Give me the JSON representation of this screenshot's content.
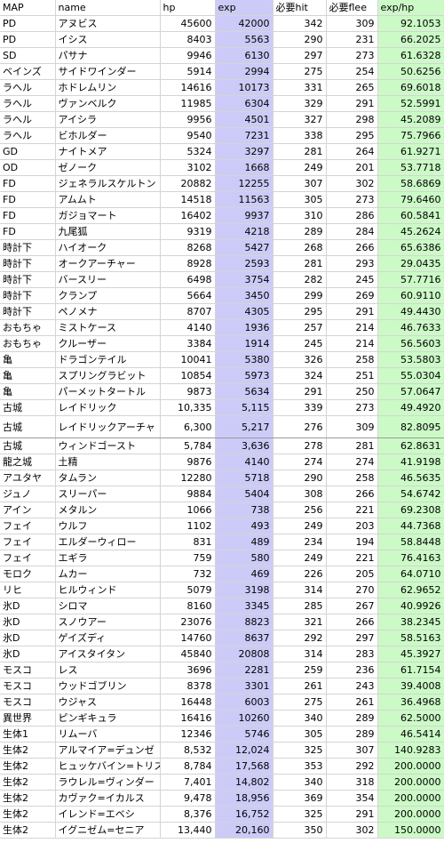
{
  "headers": [
    "MAP",
    "name",
    "hp",
    "exp",
    "必要hit",
    "必要flee",
    "exp/hp"
  ],
  "rows": [
    [
      "PD",
      "アヌビス",
      "45600",
      "42000",
      "342",
      "309",
      "92.1053"
    ],
    [
      "PD",
      "イシス",
      "8403",
      "5563",
      "290",
      "231",
      "66.2025"
    ],
    [
      "SD",
      "パサナ",
      "9946",
      "6130",
      "297",
      "273",
      "61.6328"
    ],
    [
      "ベインズ",
      "サイドワインダー",
      "5914",
      "2994",
      "275",
      "254",
      "50.6256"
    ],
    [
      "ラヘル",
      "ホドレムリン",
      "14616",
      "10173",
      "331",
      "265",
      "69.6018"
    ],
    [
      "ラヘル",
      "ヴァンベルク",
      "11985",
      "6304",
      "329",
      "291",
      "52.5991"
    ],
    [
      "ラヘル",
      "アイシラ",
      "9956",
      "4501",
      "327",
      "298",
      "45.2089"
    ],
    [
      "ラヘル",
      "ビホルダー",
      "9540",
      "7231",
      "338",
      "295",
      "75.7966"
    ],
    [
      "GD",
      "ナイトメア",
      "5324",
      "3297",
      "281",
      "264",
      "61.9271"
    ],
    [
      "OD",
      "ゼノーク",
      "3102",
      "1668",
      "249",
      "201",
      "53.7718"
    ],
    [
      "FD",
      "ジェネラルスケルトン",
      "20882",
      "12255",
      "307",
      "302",
      "58.6869"
    ],
    [
      "FD",
      "アムムト",
      "14518",
      "11563",
      "305",
      "273",
      "79.6460"
    ],
    [
      "FD",
      "ガジョマート",
      "16402",
      "9937",
      "310",
      "286",
      "60.5841"
    ],
    [
      "FD",
      "九尾狐",
      "9319",
      "4218",
      "289",
      "284",
      "45.2624"
    ],
    [
      "時計下",
      "ハイオーク",
      "8268",
      "5427",
      "268",
      "266",
      "65.6386"
    ],
    [
      "時計下",
      "オークアーチャー",
      "8928",
      "2593",
      "281",
      "293",
      "29.0435"
    ],
    [
      "時計下",
      "バースリー",
      "6498",
      "3754",
      "282",
      "245",
      "57.7716"
    ],
    [
      "時計下",
      "クランプ",
      "5664",
      "3450",
      "299",
      "269",
      "60.9110"
    ],
    [
      "時計下",
      "ペノメナ",
      "8707",
      "4305",
      "295",
      "291",
      "49.4430"
    ],
    [
      "おもちゃ",
      "ミストケース",
      "4140",
      "1936",
      "257",
      "214",
      "46.7633"
    ],
    [
      "おもちゃ",
      "クルーザー",
      "3384",
      "1914",
      "245",
      "214",
      "56.5603"
    ],
    [
      "亀",
      "ドラゴンテイル",
      "10041",
      "5380",
      "326",
      "258",
      "53.5803"
    ],
    [
      "亀",
      "スプリングラビット",
      "10854",
      "5973",
      "324",
      "251",
      "55.0304"
    ],
    [
      "亀",
      "パーメットタートル",
      "9873",
      "5634",
      "291",
      "250",
      "57.0647"
    ],
    [
      "古城",
      "レイドリック",
      "10,335",
      "5,115",
      "339",
      "273",
      "49.4920"
    ],
    [
      "古城",
      "レイドリックアーチャ",
      "6,300",
      "5,217",
      "276",
      "309",
      "82.8095"
    ],
    [
      "古城",
      "ウィンドゴースト",
      "5,784",
      "3,636",
      "278",
      "281",
      "62.8631"
    ],
    [
      "龍之城",
      "土精",
      "9876",
      "4140",
      "274",
      "274",
      "41.9198"
    ],
    [
      "アユタヤ",
      "タムラン",
      "12280",
      "5718",
      "290",
      "258",
      "46.5635"
    ],
    [
      "ジュノ",
      "スリーパー",
      "9884",
      "5404",
      "308",
      "266",
      "54.6742"
    ],
    [
      "アイン",
      "メタルン",
      "1066",
      "738",
      "256",
      "221",
      "69.2308"
    ],
    [
      "フェイ",
      "ウルフ",
      "1102",
      "493",
      "249",
      "203",
      "44.7368"
    ],
    [
      "フェイ",
      "エルダーウィロー",
      "831",
      "489",
      "234",
      "194",
      "58.8448"
    ],
    [
      "フェイ",
      "エギラ",
      "759",
      "580",
      "249",
      "221",
      "76.4163"
    ],
    [
      "モロク",
      "ムカー",
      "732",
      "469",
      "226",
      "205",
      "64.0710"
    ],
    [
      "リヒ",
      "ヒルウィンド",
      "5079",
      "3198",
      "314",
      "270",
      "62.9652"
    ],
    [
      "氷D",
      "シロマ",
      "8160",
      "3345",
      "285",
      "267",
      "40.9926"
    ],
    [
      "氷D",
      "スノウアー",
      "23076",
      "8823",
      "321",
      "266",
      "38.2345"
    ],
    [
      "氷D",
      "ゲイズディ",
      "14760",
      "8637",
      "292",
      "297",
      "58.5163"
    ],
    [
      "氷D",
      "アイスタイタン",
      "45840",
      "20808",
      "314",
      "283",
      "45.3927"
    ],
    [
      "モスコ",
      "レス",
      "3696",
      "2281",
      "259",
      "236",
      "61.7154"
    ],
    [
      "モスコ",
      "ウッドゴブリン",
      "8378",
      "3301",
      "261",
      "243",
      "39.4008"
    ],
    [
      "モスコ",
      "ウジャス",
      "16448",
      "6003",
      "275",
      "261",
      "36.4968"
    ],
    [
      "異世界",
      "ピンギキュラ",
      "16416",
      "10260",
      "340",
      "289",
      "62.5000"
    ],
    [
      "生体1",
      "リムーバ",
      "12346",
      "5746",
      "305",
      "289",
      "46.5414"
    ],
    [
      "生体2",
      "アルマイア=デュンゼ",
      "8,532",
      "12,024",
      "325",
      "307",
      "140.9283"
    ],
    [
      "生体2",
      "ヒュッケバイン=トリス",
      "8,784",
      "17,568",
      "353",
      "292",
      "200.0000"
    ],
    [
      "生体2",
      "ラウレル=ヴィンダー",
      "7,401",
      "14,802",
      "340",
      "318",
      "200.0000"
    ],
    [
      "生体2",
      "カヴァク=イカルス",
      "9,478",
      "18,956",
      "369",
      "354",
      "200.0000"
    ],
    [
      "生体2",
      "イレンド=エベシ",
      "8,376",
      "16,752",
      "325",
      "291",
      "200.0000"
    ],
    [
      "生体2",
      "イグニゼム=セニア",
      "13,440",
      "20,160",
      "350",
      "302",
      "150.0000"
    ]
  ],
  "colors": {
    "exp_column": "#cccbf7",
    "ratio_column": "#ccfac7",
    "grid": "#d4d4d4"
  }
}
